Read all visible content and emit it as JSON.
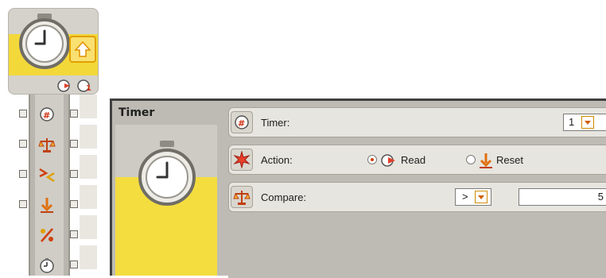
{
  "block": {
    "sensor_icon": "stopwatch-icon",
    "output_icon": "output-arrow-icon",
    "bottom_icons": [
      "timer-read-icon",
      "timer-number-icon"
    ],
    "plugs": [
      {
        "icon": "timer-number-icon"
      },
      {
        "icon": "compare-scale-icon"
      },
      {
        "icon": "greater-less-icon"
      },
      {
        "icon": "reset-arrow-icon"
      },
      {
        "icon": "percent-logic-icon"
      },
      {
        "icon": "timer-value-icon"
      }
    ]
  },
  "panel": {
    "title": "Timer",
    "colors": {
      "yellow": "#f4dd3f",
      "panel": "#bdbbb3",
      "row": "#e7e5df",
      "accent": "#d06000"
    },
    "timer": {
      "label": "Timer:",
      "value": "1",
      "icon": "timer-number-icon"
    },
    "action": {
      "label": "Action:",
      "icon": "action-star-icon",
      "options": [
        {
          "label": "Read",
          "selected": true,
          "icon": "timer-read-icon"
        },
        {
          "label": "Reset",
          "selected": false,
          "icon": "reset-arrow-icon"
        }
      ]
    },
    "compare": {
      "label": "Compare:",
      "operator": ">",
      "value": "5",
      "icon": "compare-scale-icon"
    }
  }
}
